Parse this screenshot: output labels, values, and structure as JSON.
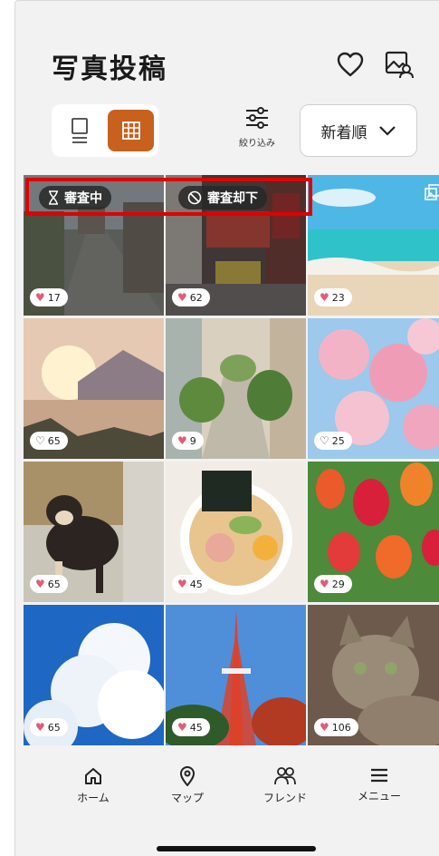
{
  "header": {
    "title": "写真投稿"
  },
  "toolbar": {
    "filter_label": "絞り込み",
    "sort_selected": "新着順"
  },
  "colors": {
    "accent": "#c8601e",
    "like": "#e25c7a",
    "highlight": "#e00000"
  },
  "photos": [
    {
      "subject": "street",
      "likes": "17",
      "liked": true,
      "status": "審査中",
      "status_icon": "hourglass-icon"
    },
    {
      "subject": "city-signs",
      "likes": "62",
      "liked": true,
      "status": "審査却下",
      "status_icon": "prohibited-icon"
    },
    {
      "subject": "beach",
      "likes": "23",
      "liked": true,
      "multi": true
    },
    {
      "subject": "lake-sunset",
      "likes": "65",
      "liked": false
    },
    {
      "subject": "alley",
      "likes": "9",
      "liked": true
    },
    {
      "subject": "cherry-blossom",
      "likes": "25",
      "liked": false
    },
    {
      "subject": "shiba-dog",
      "likes": "65",
      "liked": true
    },
    {
      "subject": "ramen",
      "likes": "45",
      "liked": true
    },
    {
      "subject": "tulips",
      "likes": "29",
      "liked": true
    },
    {
      "subject": "clouds",
      "likes": "65",
      "liked": true
    },
    {
      "subject": "tokyo-tower",
      "likes": "45",
      "liked": true
    },
    {
      "subject": "cat",
      "likes": "106",
      "liked": true
    }
  ],
  "nav": {
    "home": "ホーム",
    "map": "マップ",
    "friends": "フレンド",
    "menu": "メニュー"
  }
}
